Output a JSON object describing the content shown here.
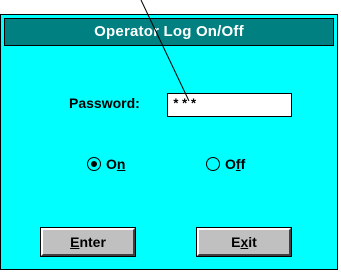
{
  "dialog": {
    "title": "Operator Log On/Off"
  },
  "password": {
    "label": "Password:",
    "value": "***"
  },
  "mode": {
    "options": [
      {
        "text": "On",
        "mnemonic": "n",
        "selected": true
      },
      {
        "text": "Off",
        "mnemonic": "f",
        "selected": false
      }
    ]
  },
  "buttons": {
    "enter": {
      "text": "Enter",
      "mnemonic": "E"
    },
    "exit": {
      "text": "Exit",
      "mnemonic": "x"
    }
  },
  "colors": {
    "window_bg": "#00ffff",
    "titlebar_bg": "#008080",
    "button_bg": "#c0c0c0"
  }
}
